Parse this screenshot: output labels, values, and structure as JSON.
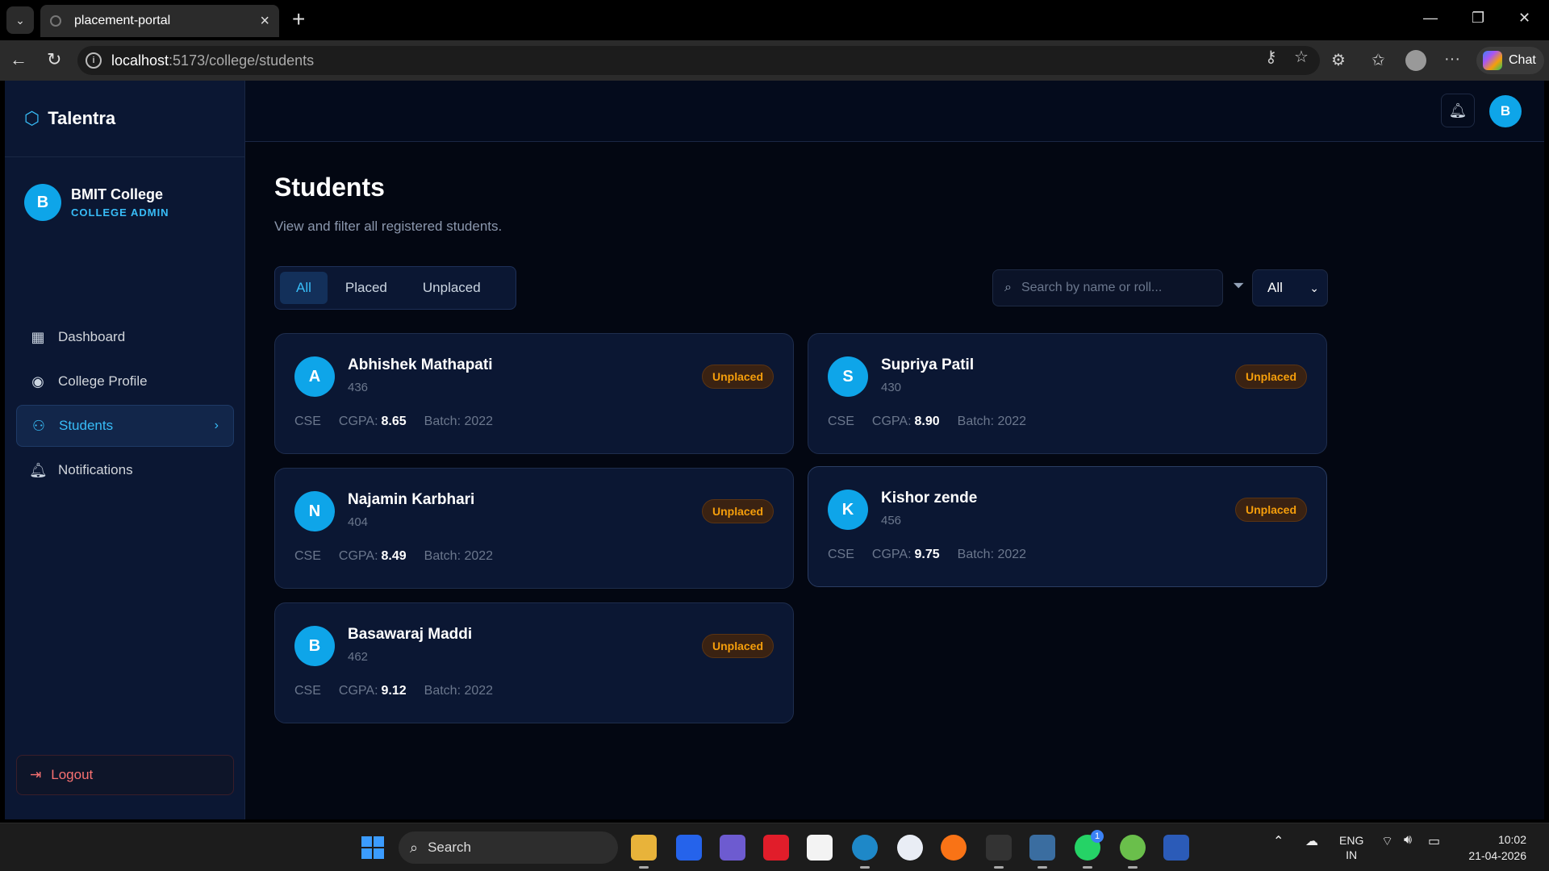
{
  "browser": {
    "tab_title": "placement-portal",
    "url_host": "localhost",
    "url_path": ":5173/college/students",
    "chat_label": "Chat"
  },
  "sidebar": {
    "brand": "Talentra",
    "college_initial": "B",
    "college_name": "BMIT College",
    "college_role": "COLLEGE ADMIN",
    "items": [
      {
        "label": "Dashboard",
        "icon": "grid-icon"
      },
      {
        "label": "College Profile",
        "icon": "user-circle-icon"
      },
      {
        "label": "Students",
        "icon": "users-icon",
        "active": true
      },
      {
        "label": "Notifications",
        "icon": "bell-icon"
      }
    ],
    "logout_label": "Logout"
  },
  "topbar": {
    "avatar_initial": "B"
  },
  "main": {
    "title": "Students",
    "subtitle": "View and filter all registered students.",
    "tabs": [
      "All",
      "Placed",
      "Unplaced"
    ],
    "search_placeholder": "Search by name or roll...",
    "branch_select": "All"
  },
  "students": [
    {
      "initial": "A",
      "name": "Abhishek Mathapati",
      "roll": "436",
      "status": "Unplaced",
      "branch": "CSE",
      "cgpa_label": "CGPA:",
      "cgpa": "8.65",
      "batch": "Batch: 2022"
    },
    {
      "initial": "S",
      "name": "Supriya Patil",
      "roll": "430",
      "status": "Unplaced",
      "branch": "CSE",
      "cgpa_label": "CGPA:",
      "cgpa": "8.90",
      "batch": "Batch: 2022"
    },
    {
      "initial": "N",
      "name": "Najamin Karbhari",
      "roll": "404",
      "status": "Unplaced",
      "branch": "CSE",
      "cgpa_label": "CGPA:",
      "cgpa": "8.49",
      "batch": "Batch: 2022"
    },
    {
      "initial": "K",
      "name": "Kishor zende",
      "roll": "456",
      "status": "Unplaced",
      "branch": "CSE",
      "cgpa_label": "CGPA:",
      "cgpa": "9.75",
      "batch": "Batch: 2022"
    },
    {
      "initial": "B",
      "name": "Basawaraj Maddi",
      "roll": "462",
      "status": "Unplaced",
      "branch": "CSE",
      "cgpa_label": "CGPA:",
      "cgpa": "9.12",
      "batch": "Batch: 2022"
    }
  ],
  "taskbar": {
    "search_label": "Search",
    "lang_top": "ENG",
    "lang_bottom": "IN",
    "time": "10:02",
    "date": "21-04-2026",
    "whatsapp_badge": "1"
  },
  "colors": {
    "accent": "#38bdf8",
    "avatar": "#0ea5e9",
    "unplaced": "#f59e0b",
    "logout": "#f87171",
    "background": "#030712",
    "sidebar": "#0b1733"
  }
}
